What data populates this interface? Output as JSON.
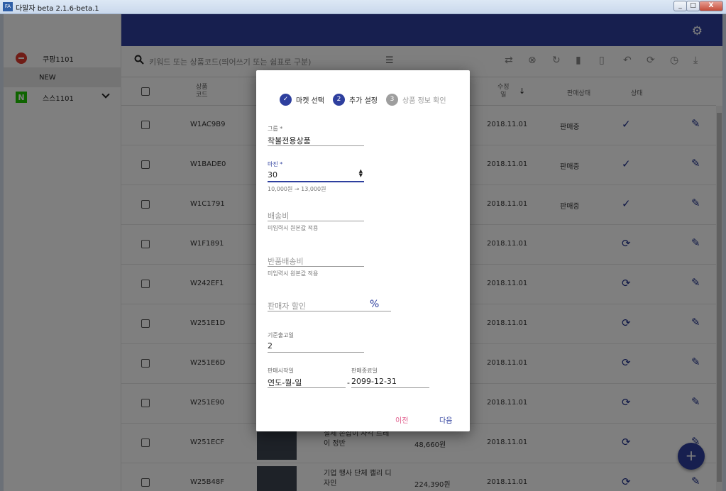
{
  "window": {
    "title": "다말자 beta 2.1.6-beta.1",
    "app_icon": "FA",
    "min": "_",
    "max": "□",
    "close": "X"
  },
  "sidebar": {
    "items": [
      {
        "label": "쿠팡1101",
        "icon": "coupang-logo"
      },
      {
        "label": "NEW"
      },
      {
        "label": "스스1101",
        "icon": "naver-logo",
        "logo_text": "N"
      }
    ]
  },
  "toolbar": {
    "search_placeholder": "키워드 또는 상품코드(띄어쓰기 또는 쉼표로 구분)",
    "icons": [
      "swap-icon",
      "cancel-icon",
      "refresh-icon",
      "delete-icon",
      "delete-outline-icon",
      "undo-icon",
      "sync-icon",
      "history-icon",
      "download-icon"
    ]
  },
  "table": {
    "headers": {
      "code": "상품\n코드",
      "modified": "수정\n일",
      "sale_status": "판매상태",
      "status": "상태"
    },
    "rows": [
      {
        "code": "W1AC9B9",
        "date": "2018.11.01",
        "sale": "판매중",
        "status": "check"
      },
      {
        "code": "W1BADE0",
        "date": "2018.11.01",
        "sale": "판매중",
        "status": "check"
      },
      {
        "code": "W1C1791",
        "date": "2018.11.01",
        "sale": "판매중",
        "status": "check"
      },
      {
        "code": "W1F1891",
        "date": "2018.11.01",
        "sale": "",
        "status": "sync"
      },
      {
        "code": "W242EF1",
        "date": "2018.11.01",
        "sale": "",
        "status": "sync"
      },
      {
        "code": "W251E1D",
        "date": "2018.11.01",
        "sale": "",
        "status": "sync"
      },
      {
        "code": "W251E6D",
        "date": "2018.11.01",
        "sale": "",
        "status": "sync"
      },
      {
        "code": "W251E90",
        "date": "2018.11.01",
        "sale": "",
        "status": "sync"
      },
      {
        "code": "W251ECF",
        "date": "2018.11.01",
        "sale": "",
        "status": "sync",
        "name": "철제 손잡이 사각 트레이 정반",
        "price": "48,660원"
      },
      {
        "code": "W25B48F",
        "date": "2018.11.01",
        "sale": "",
        "status": "sync",
        "name": "기업 행사 단체 캘리 디자인",
        "price": "224,390원"
      }
    ]
  },
  "dialog": {
    "steps": [
      {
        "num": "✓",
        "label": "마켓 선택",
        "state": "done"
      },
      {
        "num": "2",
        "label": "추가 설정",
        "state": "active"
      },
      {
        "num": "3",
        "label": "상품 정보 확인",
        "state": "inactive"
      }
    ],
    "group": {
      "label": "그룹 *",
      "value": "착불전용상품"
    },
    "margin": {
      "label": "마진 *",
      "value": "30",
      "help": "10,000원 → 13,000원"
    },
    "shipping": {
      "placeholder": "배송비",
      "help": "미입력시 원본값 적용"
    },
    "return_shipping": {
      "placeholder": "반품배송비",
      "help": "미입력시 원본값 적용"
    },
    "seller_discount": {
      "placeholder": "판매자 할인",
      "unit": "%"
    },
    "release_days": {
      "label": "기준출고일",
      "value": "2"
    },
    "sale_start": {
      "label": "판매시작일",
      "value": "연도-월-일"
    },
    "sale_end": {
      "label": "판매종료일",
      "value": "2099-12-31"
    },
    "range_sep": "-",
    "prev": "이전",
    "next": "다음"
  }
}
